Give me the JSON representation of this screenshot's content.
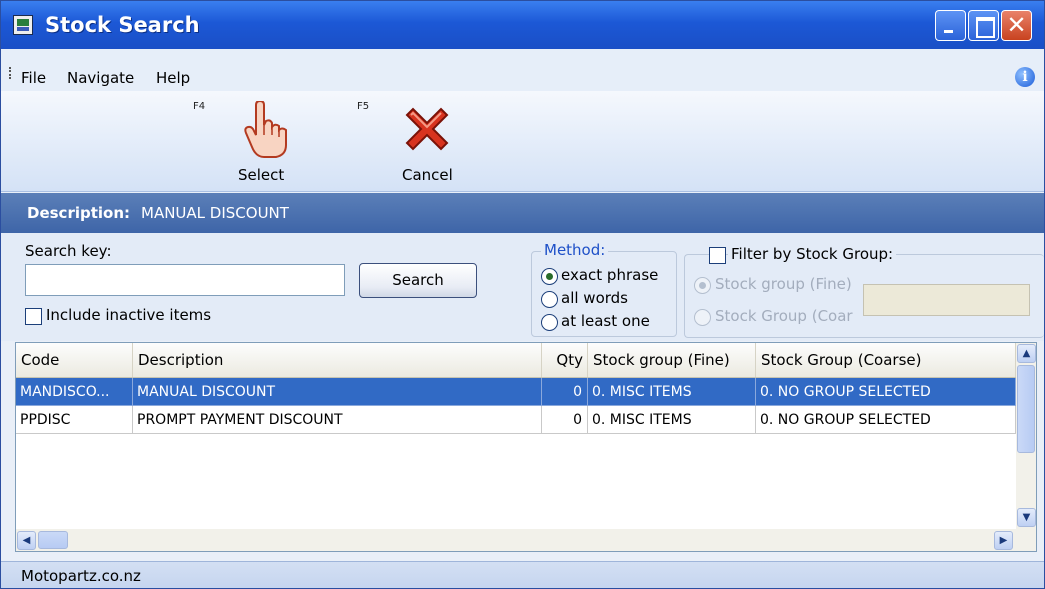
{
  "window": {
    "title": "Stock Search"
  },
  "menu": {
    "items": [
      "File",
      "Navigate",
      "Help"
    ]
  },
  "toolbar": {
    "select": {
      "hotkey": "F4",
      "label": "Select"
    },
    "cancel": {
      "hotkey": "F5",
      "label": "Cancel"
    }
  },
  "description_bar": {
    "label": "Description:",
    "value": "MANUAL DISCOUNT"
  },
  "search": {
    "key_label": "Search key:",
    "key_value": "",
    "search_button": "Search",
    "include_inactive_label": "Include inactive items",
    "include_inactive_checked": false
  },
  "method": {
    "title": "Method:",
    "options": [
      "exact phrase",
      "all words",
      "at least one"
    ],
    "selected": "exact phrase"
  },
  "filter": {
    "label": "Filter by Stock Group:",
    "checked": false,
    "options": [
      "Stock group (Fine)",
      "Stock Group (Coar"
    ],
    "selected": "Stock group (Fine)",
    "value": ""
  },
  "grid": {
    "columns": [
      "Code",
      "Description",
      "Qty",
      "Stock group (Fine)",
      "Stock Group (Coarse)"
    ],
    "rows": [
      {
        "code": "MANDISCO...",
        "description": "MANUAL DISCOUNT",
        "qty": "0",
        "fine": "0. MISC ITEMS",
        "coarse": "0. NO GROUP SELECTED",
        "selected": true
      },
      {
        "code": "PPDISC",
        "description": "PROMPT PAYMENT DISCOUNT",
        "qty": "0",
        "fine": "0. MISC ITEMS",
        "coarse": "0. NO GROUP SELECTED",
        "selected": false
      }
    ]
  },
  "status": {
    "text": "Motopartz.co.nz"
  },
  "icons": {
    "app": "app-icon",
    "info": "info-icon",
    "select": "pointing-hand-icon",
    "cancel": "red-x-icon"
  },
  "colors": {
    "titlebar": "#1c58d6",
    "description_bar": "#4a6fae",
    "selected_row": "#316ac5"
  }
}
